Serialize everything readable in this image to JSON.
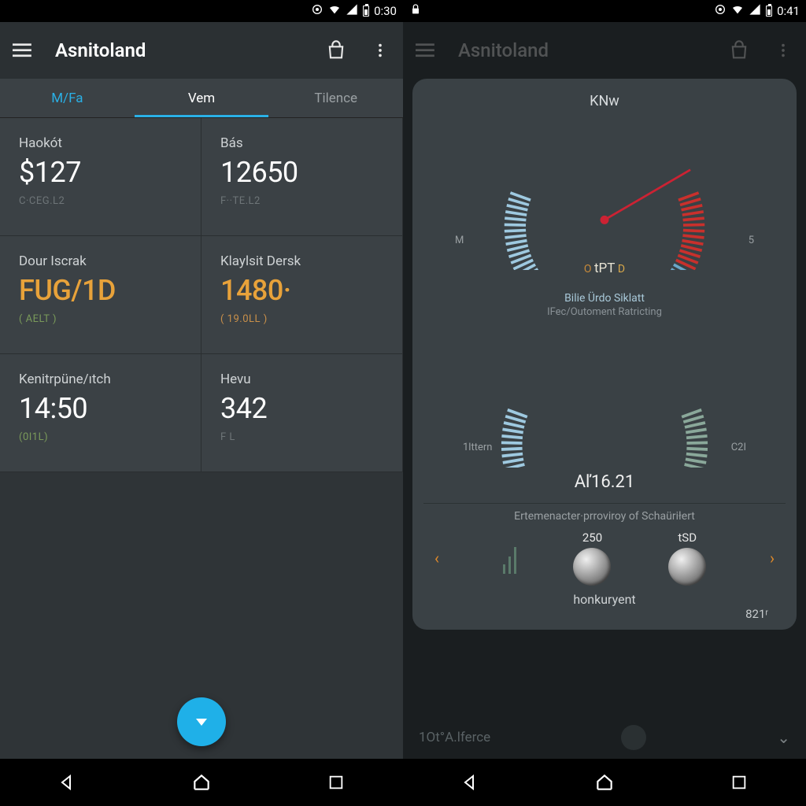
{
  "left": {
    "status_time": "0:30",
    "app_title": "Asnitoland",
    "tabs": [
      {
        "label": "M/Fa",
        "mode": "accent"
      },
      {
        "label": "Vem",
        "mode": "active"
      },
      {
        "label": "Tilence",
        "mode": ""
      }
    ],
    "cells": [
      {
        "label": "Haokót",
        "value": "$127",
        "sub": "C·CEG.L2",
        "value_class": "",
        "sub_class": ""
      },
      {
        "label": "Bás",
        "value": "12650",
        "sub": "F··TE.L2",
        "value_class": "",
        "sub_class": ""
      },
      {
        "label": "Dour Iscrak",
        "value": "FUG/1D",
        "sub": "( AELT )",
        "value_class": "orange",
        "sub_class": "green"
      },
      {
        "label": "Klaylsit Dersk",
        "value": "1480·",
        "sub": "( 19.0LL )",
        "value_class": "orange",
        "sub_class": "orange"
      },
      {
        "label": "Kenitrpüne/ıtch",
        "value": "14:50",
        "sub": "(0I1L)",
        "value_class": "",
        "sub_class": "green"
      },
      {
        "label": "Hevu",
        "value": "342",
        "sub": "F  L",
        "value_class": "",
        "sub_class": ""
      }
    ]
  },
  "right": {
    "status_time": "0:41",
    "app_title": "Asnitoland",
    "gauge1_title": "KNw",
    "gauge1_center_prefix": "O",
    "gauge1_center": "tPT",
    "gauge1_center_suffix": "D",
    "gauge2_title": "Bilie Ürdo Siklatt",
    "gauge2_sub": "IFec/Outoment Ratricting",
    "gauge2_left": "1lttern",
    "gauge2_right": "C2I",
    "gauge2_value": "Aľ16.21",
    "bottom_title": "Ertemenacter·prroviroy of Schaüriłert",
    "bottom_left_val": "250",
    "bottom_right_val": "tSD",
    "footer_label": "honkuryent",
    "footer_val": "821ʳ",
    "dim_label": "1Ot°A.lferce"
  }
}
